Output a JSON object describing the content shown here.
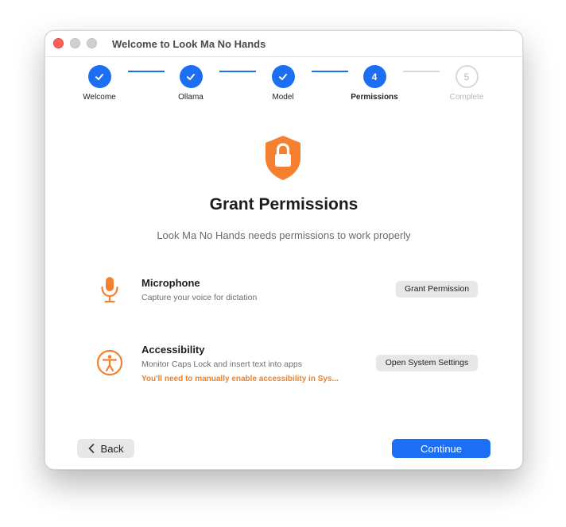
{
  "window": {
    "title": "Welcome to Look Ma No Hands"
  },
  "steps": [
    {
      "label": "Welcome",
      "status": "done"
    },
    {
      "label": "Ollama",
      "status": "done"
    },
    {
      "label": "Model",
      "status": "done"
    },
    {
      "label": "Permissions",
      "number": "4",
      "status": "current"
    },
    {
      "label": "Complete",
      "number": "5",
      "status": "pending"
    }
  ],
  "header": {
    "icon": "lock-shield-icon",
    "title": "Grant Permissions",
    "subtitle": "Look Ma No Hands needs permissions to work properly"
  },
  "permissions": [
    {
      "icon": "microphone-icon",
      "title": "Microphone",
      "description": "Capture your voice for dictation",
      "button": "Grant Permission"
    },
    {
      "icon": "accessibility-icon",
      "title": "Accessibility",
      "description": "Monitor Caps Lock and insert text into apps",
      "warning": "You'll need to manually enable accessibility in Sys...",
      "button": "Open System Settings"
    }
  ],
  "footer": {
    "back": "Back",
    "continue": "Continue"
  },
  "colors": {
    "accent": "#1c6ef2",
    "orange": "#f0812a",
    "close": "#fe5f57"
  }
}
